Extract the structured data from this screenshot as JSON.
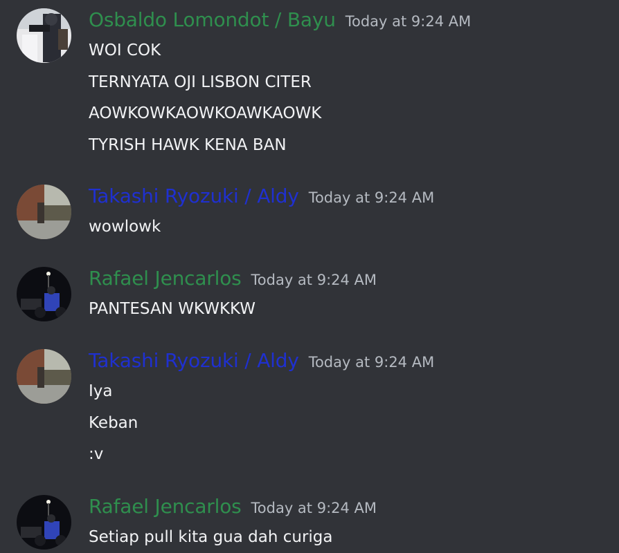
{
  "colors": {
    "background": "#313338",
    "green_user": "#2f8f4e",
    "blue_user": "#1f30d0",
    "timestamp": "#b5bac1",
    "text": "#f2f3f5"
  },
  "messages": [
    {
      "author": "Osbaldo Lomondot / Bayu",
      "time": "Today at 9:24 AM",
      "lines": [
        "WOI COK",
        "TERNYATA OJI LISBON CITER",
        "AOWKOWKAOWKOAWKAOWK",
        "TYRISH HAWK KENA BAN"
      ]
    },
    {
      "author": "Takashi Ryozuki / Aldy",
      "time": "Today at 9:24 AM",
      "lines": [
        "wowlowk"
      ]
    },
    {
      "author": "Rafael Jencarlos",
      "time": "Today at 9:24 AM",
      "lines": [
        "PANTESAN WKWKKW"
      ]
    },
    {
      "author": "Takashi Ryozuki / Aldy",
      "time": "Today at 9:24 AM",
      "lines": [
        "Iya",
        "Keban",
        ":v"
      ]
    },
    {
      "author": "Rafael Jencarlos",
      "time": "Today at 9:24 AM",
      "lines": [
        "Setiap pull kita gua dah curiga"
      ]
    }
  ]
}
